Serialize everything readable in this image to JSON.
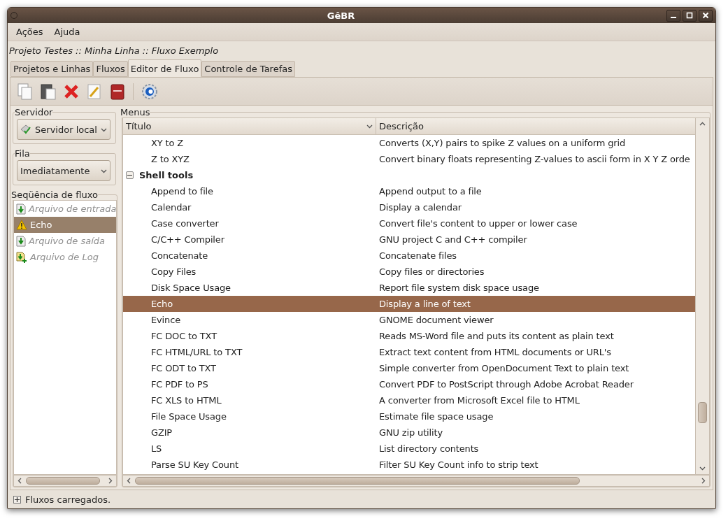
{
  "window": {
    "title": "GêBR"
  },
  "menubar": [
    {
      "label": "Ações"
    },
    {
      "label": "Ajuda"
    }
  ],
  "breadcrumb": "Projeto Testes :: Minha Linha :: Fluxo Exemplo",
  "tabs": [
    {
      "label": "Projetos e Linhas",
      "selected": false
    },
    {
      "label": "Fluxos",
      "selected": false
    },
    {
      "label": "Editor de Fluxo",
      "selected": true
    },
    {
      "label": "Controle de Tarefas",
      "selected": false
    }
  ],
  "sidebar": {
    "server": {
      "label": "Servidor",
      "value": "Servidor local"
    },
    "queue": {
      "label": "Fila",
      "value": "Imediatamente"
    },
    "sequence": {
      "label": "Seqüência de fluxo",
      "items": [
        {
          "label": "Arquivo de entrada",
          "kind": "input",
          "selected": false,
          "disabled": true
        },
        {
          "label": "Echo",
          "kind": "warning",
          "selected": true,
          "disabled": false
        },
        {
          "label": "Arquivo de saída",
          "kind": "output",
          "selected": false,
          "disabled": true
        },
        {
          "label": "Arquivo de Log",
          "kind": "log",
          "selected": false,
          "disabled": true
        }
      ]
    }
  },
  "menus": {
    "label": "Menus",
    "columns": [
      "Título",
      "Descrição"
    ],
    "rows": [
      {
        "kind": "item",
        "title": "XY to Z",
        "description": "Converts (X,Y) pairs to spike Z values on a uniform grid",
        "selected": false
      },
      {
        "kind": "item",
        "title": "Z to XYZ",
        "description": "Convert binary floats representing Z-values to ascii form in X Y Z orde",
        "selected": false
      },
      {
        "kind": "group",
        "title": "Shell tools",
        "expanded": true
      },
      {
        "kind": "item",
        "title": "Append to file",
        "description": "Append output to a file",
        "selected": false
      },
      {
        "kind": "item",
        "title": "Calendar",
        "description": "Display a calendar",
        "selected": false
      },
      {
        "kind": "item",
        "title": "Case converter",
        "description": "Convert file's content to upper or lower case",
        "selected": false
      },
      {
        "kind": "item",
        "title": "C/C++ Compiler",
        "description": "GNU project C and C++ compiler",
        "selected": false
      },
      {
        "kind": "item",
        "title": "Concatenate",
        "description": "Concatenate files",
        "selected": false
      },
      {
        "kind": "item",
        "title": "Copy Files",
        "description": "Copy files or directories",
        "selected": false
      },
      {
        "kind": "item",
        "title": "Disk Space Usage",
        "description": "Report file system disk space usage",
        "selected": false
      },
      {
        "kind": "item",
        "title": "Echo",
        "description": "Display a line of text",
        "selected": true
      },
      {
        "kind": "item",
        "title": "Evince",
        "description": "GNOME document viewer",
        "selected": false
      },
      {
        "kind": "item",
        "title": "FC DOC to TXT",
        "description": "Reads MS-Word file and puts its content as plain text",
        "selected": false
      },
      {
        "kind": "item",
        "title": "FC HTML/URL to TXT",
        "description": "Extract text content from HTML documents or URL's",
        "selected": false
      },
      {
        "kind": "item",
        "title": "FC ODT to TXT",
        "description": "Simple converter from OpenDocument Text to plain text",
        "selected": false
      },
      {
        "kind": "item",
        "title": "FC PDF to PS",
        "description": "Convert PDF to PostScript through Adobe Acrobat Reader",
        "selected": false
      },
      {
        "kind": "item",
        "title": "FC XLS to HTML",
        "description": "A converter from Microsoft Excel file to HTML",
        "selected": false
      },
      {
        "kind": "item",
        "title": "File Space Usage",
        "description": "Estimate file space usage",
        "selected": false
      },
      {
        "kind": "item",
        "title": "GZIP",
        "description": "GNU zip utility",
        "selected": false
      },
      {
        "kind": "item",
        "title": "LS",
        "description": "List directory contents",
        "selected": false
      },
      {
        "kind": "item",
        "title": "Parse SU Key Count",
        "description": "Filter SU Key Count info to strip text",
        "selected": false
      }
    ]
  },
  "status_bar": {
    "text": "Fluxos carregados.",
    "expanded": false
  }
}
